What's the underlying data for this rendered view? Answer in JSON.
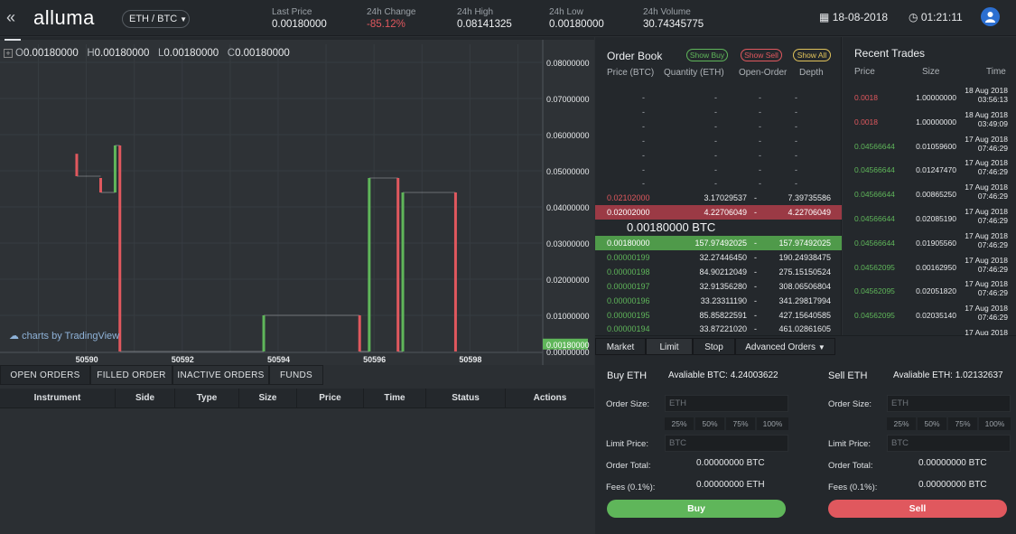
{
  "header": {
    "logo": "alluma",
    "pair": "ETH / BTC",
    "stats": [
      {
        "label": "Last Price",
        "value": "0.00180000"
      },
      {
        "label": "24h Change",
        "value": "-85.12%"
      },
      {
        "label": "24h High",
        "value": "0.08141325"
      },
      {
        "label": "24h Low",
        "value": "0.00180000"
      },
      {
        "label": "24h Volume",
        "value": "30.74345775"
      }
    ],
    "date": "18-08-2018",
    "time": "01:21:11"
  },
  "chart": {
    "ohlc": {
      "o_label": "O",
      "o": "0.00180000",
      "h_label": "H",
      "h": "0.00180000",
      "l_label": "L",
      "l": "0.00180000",
      "c_label": "C",
      "c": "0.00180000"
    },
    "attribution": "charts by TradingView"
  },
  "chart_data": {
    "type": "bar",
    "title": "",
    "ylim": [
      0,
      0.085
    ],
    "y_ticks": [
      "0.08000000",
      "0.07000000",
      "0.06000000",
      "0.05000000",
      "0.04000000",
      "0.03000000",
      "0.02000000",
      "0.01000000",
      "0.00180000",
      "0.00000000"
    ],
    "x_ticks": [
      "50590",
      "50592",
      "50594",
      "50596",
      "50598"
    ],
    "last_price_label": "0.00180000",
    "candles": [
      {
        "x": 50589.8,
        "open": 0.0547,
        "close": 0.0485,
        "color": "#e0585e"
      },
      {
        "x": 50590.3,
        "open": 0.048,
        "close": 0.044,
        "color": "#e0585e"
      },
      {
        "x": 50590.6,
        "open": 0.044,
        "close": 0.057,
        "color": "#5fb65a"
      },
      {
        "x": 50590.7,
        "open": 0.057,
        "close": 0.0,
        "color": "#e0585e"
      },
      {
        "x": 50593.7,
        "open": 0.0,
        "close": 0.01,
        "color": "#5fb65a"
      },
      {
        "x": 50595.7,
        "open": 0.01,
        "close": 0.0,
        "color": "#e0585e"
      },
      {
        "x": 50595.9,
        "open": 0.0,
        "close": 0.048,
        "color": "#5fb65a"
      },
      {
        "x": 50596.5,
        "open": 0.048,
        "close": 0.0,
        "color": "#e0585e"
      },
      {
        "x": 50596.6,
        "open": 0.0,
        "close": 0.044,
        "color": "#5fb65a"
      },
      {
        "x": 50597.7,
        "open": 0.044,
        "close": 0.0,
        "color": "#e0585e"
      }
    ]
  },
  "orders": {
    "tabs": [
      "OPEN ORDERS",
      "FILLED ORDER",
      "INACTIVE ORDERS",
      "FUNDS"
    ],
    "columns": [
      "Instrument",
      "Side",
      "Type",
      "Size",
      "Price",
      "Time",
      "Status",
      "Actions"
    ]
  },
  "orderbook": {
    "title": "Order Book",
    "show_buy": "Show Buy",
    "show_sell": "Show Sell",
    "show_all": "Show All",
    "headers": [
      "Price (BTC)",
      "Quantity (ETH)",
      "Open-Order",
      "Depth"
    ],
    "asks": [
      [
        "-",
        "-",
        "-",
        "-"
      ],
      [
        "-",
        "-",
        "-",
        "-"
      ],
      [
        "-",
        "-",
        "-",
        "-"
      ],
      [
        "-",
        "-",
        "-",
        "-"
      ],
      [
        "-",
        "-",
        "-",
        "-"
      ],
      [
        "-",
        "-",
        "-",
        "-"
      ],
      [
        "-",
        "-",
        "-",
        "-"
      ],
      [
        "0.02102000",
        "3.17029537",
        "-",
        "7.39735586"
      ],
      [
        "0.02002000",
        "4.22706049",
        "-",
        "4.22706049"
      ]
    ],
    "mid_price": "0.00180000 BTC",
    "bids": [
      [
        "0.00180000",
        "157.97492025",
        "-",
        "157.97492025"
      ],
      [
        "0.00000199",
        "32.27446450",
        "-",
        "190.24938475"
      ],
      [
        "0.00000198",
        "84.90212049",
        "-",
        "275.15150524"
      ],
      [
        "0.00000197",
        "32.91356280",
        "-",
        "308.06506804"
      ],
      [
        "0.00000196",
        "33.23311190",
        "-",
        "341.29817994"
      ],
      [
        "0.00000195",
        "85.85822591",
        "-",
        "427.15640585"
      ],
      [
        "0.00000194",
        "33.87221020",
        "-",
        "461.02861605"
      ]
    ],
    "ask_color": "#e0585e",
    "bid_color": "#5fb65a"
  },
  "recent_trades": {
    "title": "Recent Trades",
    "headers": [
      "Price",
      "Size",
      "Time"
    ],
    "rows": [
      {
        "price": "0.0018",
        "size": "1.00000000",
        "date": "18 Aug 2018",
        "time": "03:56:13",
        "side": "sell"
      },
      {
        "price": "0.0018",
        "size": "1.00000000",
        "date": "18 Aug 2018",
        "time": "03:49:09",
        "side": "sell"
      },
      {
        "price": "0.04566644",
        "size": "0.01059600",
        "date": "17 Aug 2018",
        "time": "07:46:29",
        "side": "buy"
      },
      {
        "price": "0.04566644",
        "size": "0.01247470",
        "date": "17 Aug 2018",
        "time": "07:46:29",
        "side": "buy"
      },
      {
        "price": "0.04566644",
        "size": "0.00865250",
        "date": "17 Aug 2018",
        "time": "07:46:29",
        "side": "buy"
      },
      {
        "price": "0.04566644",
        "size": "0.02085190",
        "date": "17 Aug 2018",
        "time": "07:46:29",
        "side": "buy"
      },
      {
        "price": "0.04566644",
        "size": "0.01905560",
        "date": "17 Aug 2018",
        "time": "07:46:29",
        "side": "buy"
      },
      {
        "price": "0.04562095",
        "size": "0.00162950",
        "date": "17 Aug 2018",
        "time": "07:46:29",
        "side": "buy"
      },
      {
        "price": "0.04562095",
        "size": "0.02051820",
        "date": "17 Aug 2018",
        "time": "07:46:29",
        "side": "buy"
      },
      {
        "price": "0.04562095",
        "size": "0.02035140",
        "date": "17 Aug 2018",
        "time": "07:46:29",
        "side": "buy"
      },
      {
        "price": "",
        "size": "",
        "date": "17 Aug 2018",
        "time": "",
        "side": "buy"
      }
    ]
  },
  "trade_form": {
    "tabs": [
      "Market",
      "Limit",
      "Stop",
      "Advanced Orders"
    ],
    "buy": {
      "title": "Buy ETH",
      "available": "Avaliable BTC: 4.24003622",
      "order_size_label": "Order Size:",
      "order_size_placeholder": "ETH",
      "percents": [
        "25%",
        "50%",
        "75%",
        "100%"
      ],
      "limit_price_label": "Limit Price:",
      "limit_price_placeholder": "BTC",
      "order_total_label": "Order Total:",
      "order_total": "0.00000000 BTC",
      "fees_label": "Fees (0.1%):",
      "fees": "0.00000000 ETH",
      "button": "Buy"
    },
    "sell": {
      "title": "Sell ETH",
      "available": "Avaliable ETH: 1.02132637",
      "order_size_label": "Order Size:",
      "order_size_placeholder": "ETH",
      "percents": [
        "25%",
        "50%",
        "75%",
        "100%"
      ],
      "limit_price_label": "Limit Price:",
      "limit_price_placeholder": "BTC",
      "order_total_label": "Order Total:",
      "order_total": "0.00000000 BTC",
      "fees_label": "Fees (0.1%):",
      "fees": "0.00000000 BTC",
      "button": "Sell"
    }
  }
}
